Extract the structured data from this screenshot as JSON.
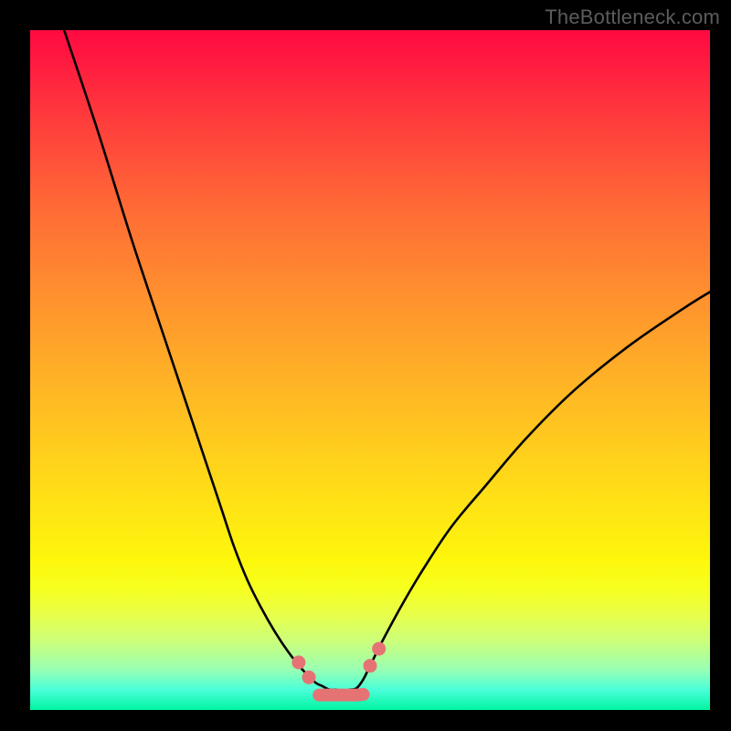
{
  "watermark": {
    "text": "TheBottleneck.com"
  },
  "chart_data": {
    "type": "line",
    "title": "",
    "xlabel": "",
    "ylabel": "",
    "xlim": [
      0,
      100
    ],
    "ylim": [
      0,
      100
    ],
    "grid": false,
    "legend": false,
    "annotations": [],
    "series": [
      {
        "name": "left-curve",
        "x": [
          5,
          10,
          15,
          20,
          25,
          28,
          30,
          32,
          34,
          36,
          38,
          40,
          41,
          42,
          43,
          44,
          45
        ],
        "values": [
          100,
          85,
          69,
          54,
          39,
          30,
          24,
          19,
          15,
          11.5,
          8.5,
          6,
          5,
          4,
          3.5,
          3,
          3
        ]
      },
      {
        "name": "right-curve",
        "x": [
          47,
          48,
          49,
          50,
          52,
          55,
          58,
          62,
          67,
          73,
          80,
          88,
          96,
          100
        ],
        "values": [
          3,
          3.2,
          4.5,
          6.5,
          10.5,
          16,
          21,
          27,
          33,
          40,
          47,
          53.5,
          59,
          61.5
        ]
      },
      {
        "name": "flat-bottom",
        "x": [
          42.5,
          44,
          45,
          46,
          47,
          48,
          49
        ],
        "values": [
          2.2,
          2.2,
          2.2,
          2.2,
          2.2,
          2.2,
          2.3
        ]
      }
    ],
    "markers": [
      {
        "name": "left-dot-1",
        "x": 39.5,
        "y": 7.0
      },
      {
        "name": "left-dot-2",
        "x": 41.0,
        "y": 4.8
      },
      {
        "name": "right-dot-1",
        "x": 50.0,
        "y": 6.5
      },
      {
        "name": "right-dot-2",
        "x": 51.3,
        "y": 9.0
      }
    ],
    "marker_color": "#e57373",
    "bottom_color": "#e57373",
    "curve_color": "#000000"
  }
}
